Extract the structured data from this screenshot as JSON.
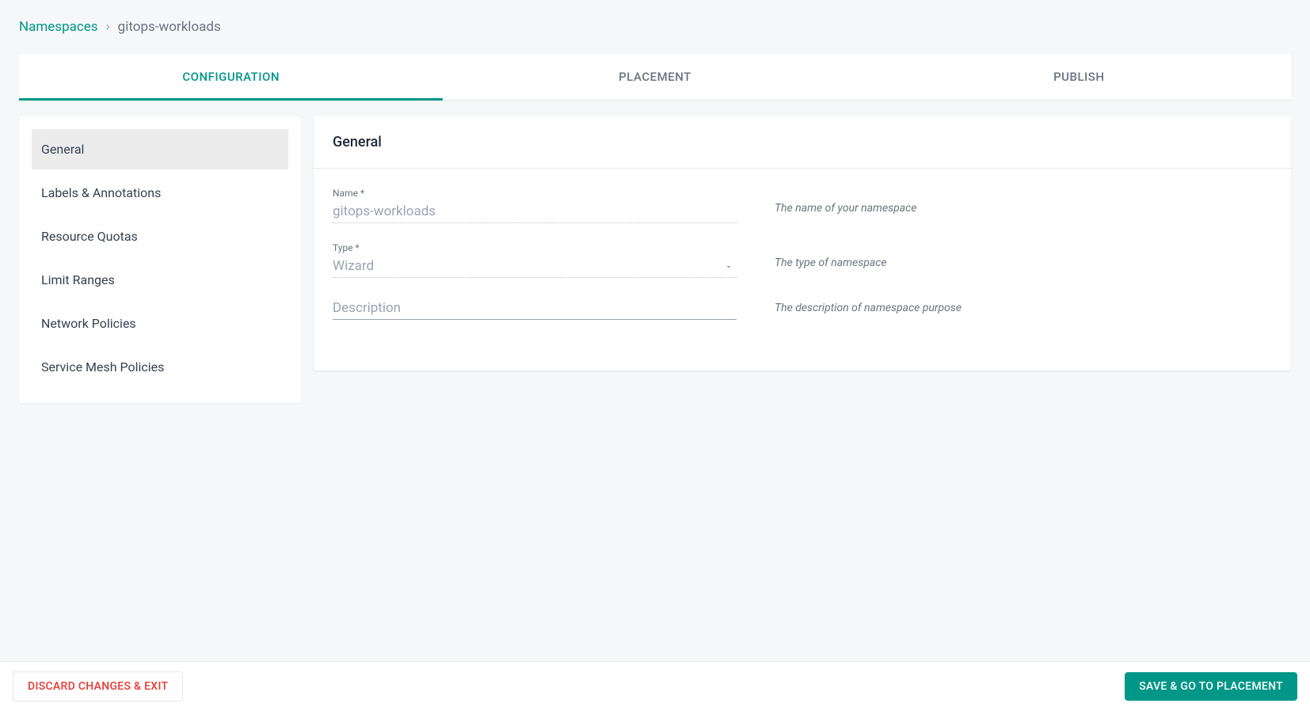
{
  "breadcrumb": {
    "root": "Namespaces",
    "separator": "›",
    "current": "gitops-workloads"
  },
  "tabs": [
    {
      "label": "CONFIGURATION",
      "active": true
    },
    {
      "label": "PLACEMENT",
      "active": false
    },
    {
      "label": "PUBLISH",
      "active": false
    }
  ],
  "sidebar": {
    "items": [
      {
        "label": "General",
        "active": true
      },
      {
        "label": "Labels & Annotations",
        "active": false
      },
      {
        "label": "Resource Quotas",
        "active": false
      },
      {
        "label": "Limit Ranges",
        "active": false
      },
      {
        "label": "Network Policies",
        "active": false
      },
      {
        "label": "Service Mesh Policies",
        "active": false
      }
    ]
  },
  "panel": {
    "title": "General",
    "fields": {
      "name": {
        "label": "Name *",
        "value": "gitops-workloads",
        "hint": "The name of your namespace"
      },
      "type": {
        "label": "Type *",
        "value": "Wizard",
        "hint": "The type of namespace"
      },
      "description": {
        "placeholder": "Description",
        "value": "",
        "hint": "The description of namespace purpose"
      }
    }
  },
  "footer": {
    "discard": "DISCARD CHANGES & EXIT",
    "save": "SAVE & GO TO PLACEMENT"
  }
}
